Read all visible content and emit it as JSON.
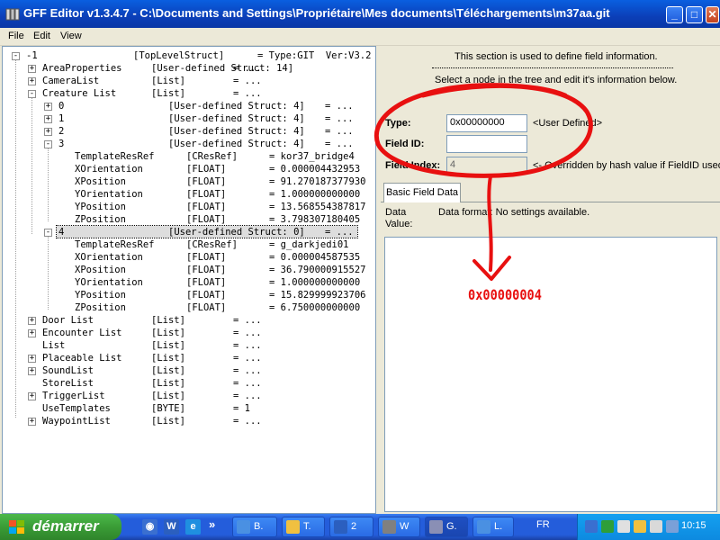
{
  "window": {
    "title": "GFF Editor v1.3.4.7 - C:\\Documents and Settings\\Propriétaire\\Mes documents\\Téléchargements\\m37aa.git",
    "min_glyph": "_",
    "max_glyph": "□",
    "close_glyph": "✕"
  },
  "menu": {
    "file": "File",
    "edit": "Edit",
    "view": "View"
  },
  "tree": [
    {
      "exp": "-",
      "name": "-1",
      "type": "[TopLevelStruct]",
      "value": "= Type:GIT  Ver:V3.2"
    },
    {
      "exp": "+",
      "name": "AreaProperties",
      "type": "[User-defined Struct: 14]",
      "value": "= ..."
    },
    {
      "exp": "+",
      "name": "CameraList",
      "type": "[List]",
      "value": "= ..."
    },
    {
      "exp": "-",
      "name": "Creature List",
      "type": "[List]",
      "value": "= ..."
    },
    {
      "exp": "+",
      "name": "0",
      "type": "[User-defined Struct: 4]",
      "value": "= ..."
    },
    {
      "exp": "+",
      "name": "1",
      "type": "[User-defined Struct: 4]",
      "value": "= ..."
    },
    {
      "exp": "+",
      "name": "2",
      "type": "[User-defined Struct: 4]",
      "value": "= ..."
    },
    {
      "exp": "-",
      "name": "3",
      "type": "[User-defined Struct: 4]",
      "value": "= ..."
    },
    {
      "exp": "",
      "name": "TemplateResRef",
      "type": "[CResRef]",
      "value": "= kor37_bridge4"
    },
    {
      "exp": "",
      "name": "XOrientation",
      "type": "[FLOAT]",
      "value": "= 0.000004432953"
    },
    {
      "exp": "",
      "name": "XPosition",
      "type": "[FLOAT]",
      "value": "= 91.270187377930"
    },
    {
      "exp": "",
      "name": "YOrientation",
      "type": "[FLOAT]",
      "value": "= 1.000000000000"
    },
    {
      "exp": "",
      "name": "YPosition",
      "type": "[FLOAT]",
      "value": "= 13.568554387817"
    },
    {
      "exp": "",
      "name": "ZPosition",
      "type": "[FLOAT]",
      "value": "= 3.798307180405"
    },
    {
      "exp": "-",
      "name": "4",
      "type": "[User-defined Struct: 0]",
      "value": "= ..."
    },
    {
      "exp": "",
      "name": "TemplateResRef",
      "type": "[CResRef]",
      "value": "= g_darkjedi01"
    },
    {
      "exp": "",
      "name": "XOrientation",
      "type": "[FLOAT]",
      "value": "= 0.000004587535"
    },
    {
      "exp": "",
      "name": "XPosition",
      "type": "[FLOAT]",
      "value": "= 36.790000915527"
    },
    {
      "exp": "",
      "name": "YOrientation",
      "type": "[FLOAT]",
      "value": "= 1.000000000000"
    },
    {
      "exp": "",
      "name": "YPosition",
      "type": "[FLOAT]",
      "value": "= 15.829999923706"
    },
    {
      "exp": "",
      "name": "ZPosition",
      "type": "[FLOAT]",
      "value": "= 6.750000000000"
    },
    {
      "exp": "+",
      "name": "Door List",
      "type": "[List]",
      "value": "= ..."
    },
    {
      "exp": "+",
      "name": "Encounter List",
      "type": "[List]",
      "value": "= ..."
    },
    {
      "exp": "",
      "name": "List",
      "type": "[List]",
      "value": "= ..."
    },
    {
      "exp": "+",
      "name": "Placeable List",
      "type": "[List]",
      "value": "= ..."
    },
    {
      "exp": "+",
      "name": "SoundList",
      "type": "[List]",
      "value": "= ..."
    },
    {
      "exp": "",
      "name": "StoreList",
      "type": "[List]",
      "value": "= ..."
    },
    {
      "exp": "+",
      "name": "TriggerList",
      "type": "[List]",
      "value": "= ..."
    },
    {
      "exp": "",
      "name": "UseTemplates",
      "type": "[BYTE]",
      "value": "= 1"
    },
    {
      "exp": "+",
      "name": "WaypointList",
      "type": "[List]",
      "value": "= ..."
    }
  ],
  "right": {
    "info_line1": "This section is used to define field information.",
    "info_line2": "Select a node in the tree and edit it's information below.",
    "type_label": "Type:",
    "type_value": "0x00000000",
    "type_note": "<User Defined>",
    "field_id_label": "Field ID:",
    "field_id_value": "",
    "field_index_label": "Field Index:",
    "field_index_value": "4",
    "field_index_note": "<- Overridden by hash value if FieldID used.",
    "tab_label": "Basic Field Data",
    "data_value_label_1": "Data",
    "data_value_label_2": "Value:",
    "data_format_text": "Data format: No settings available."
  },
  "annotation": {
    "text": "0x00000004",
    "color": "#e81010"
  },
  "taskbar": {
    "start_label": "démarrer",
    "overflow": "»",
    "tasks": [
      {
        "label": "B.",
        "icon_color": "#4a90e2"
      },
      {
        "label": "T.",
        "icon_color": "#f0c040"
      },
      {
        "label": "2",
        "icon_color": "#2b5fbf"
      },
      {
        "label": "W",
        "icon_color": "#808080"
      },
      {
        "label": "G.",
        "icon_color": "#8a8fb5"
      },
      {
        "label": "L.",
        "icon_color": "#4a90e2"
      }
    ],
    "quick_launch": [
      {
        "glyph": "◉",
        "color": "#3a6fd0"
      },
      {
        "glyph": "W",
        "color": "#2b5fbf"
      },
      {
        "glyph": "e",
        "color": "#1f8fe0"
      }
    ],
    "language": "FR",
    "clock": "10:15"
  }
}
